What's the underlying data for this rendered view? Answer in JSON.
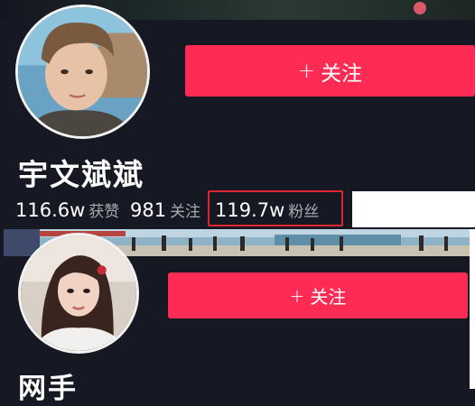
{
  "profiles": [
    {
      "name": "宇文斌斌",
      "follow_button": "关注",
      "stats": [
        {
          "value": "116.6w",
          "label": "获赞"
        },
        {
          "value": "981",
          "label": "关注"
        },
        {
          "value": "119.7w",
          "label": "粉丝"
        }
      ]
    },
    {
      "name": "网手",
      "follow_button": "关注"
    }
  ],
  "colors": {
    "background": "#161823",
    "follow_button": "#fe2c55",
    "highlight_box": "#e0262e"
  },
  "icons": {
    "follow": "plus-icon"
  }
}
